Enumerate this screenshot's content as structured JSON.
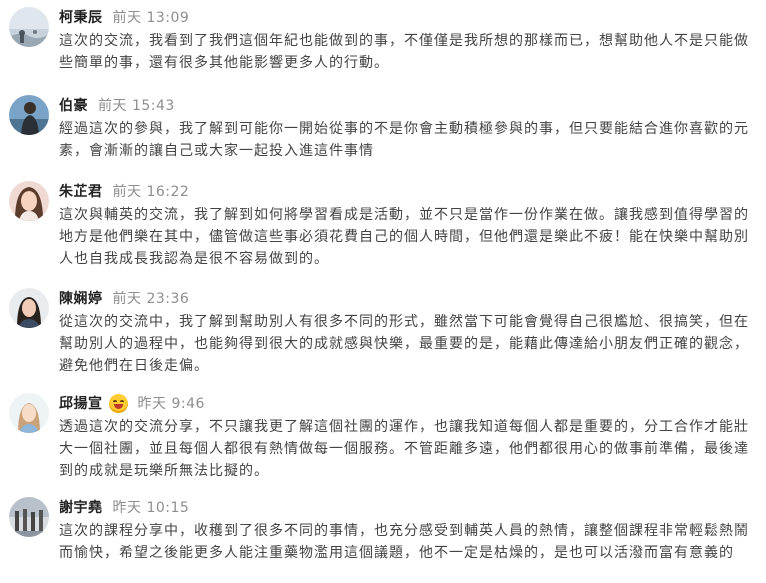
{
  "comments": [
    {
      "name": "柯秉辰",
      "time": "前天 13:09",
      "text": "這次的交流，我看到了我們這個年紀也能做到的事，不僅僅是我所想的那樣而已，想幫助他人不是只能做些簡單的事，還有很多其他能影響更多人的行動。"
    },
    {
      "name": "伯豪",
      "time": "前天 15:43",
      "text": "經過這次的參與，我了解到可能你一開始從事的不是你會主動積極參與的事，但只要能結合進你喜歡的元素，會漸漸的讓自己或大家一起投入進這件事情"
    },
    {
      "name": "朱芷君",
      "time": "前天 16:22",
      "text": "這次與輔英的交流，我了解到如何將學習看成是活動，並不只是當作一份作業在做。讓我感到值得學習的地方是他們樂在其中，儘管做這些事必須花費自己的個人時間，但他們還是樂此不疲！能在快樂中幫助別人也自我成長我認為是很不容易做到的。"
    },
    {
      "name": "陳娴婷",
      "time": "前天 23:36",
      "text": "從這次的交流中，我了解到幫助別人有很多不同的形式，雖然當下可能會覺得自己很尷尬、很搞笑，但在幫助別人的過程中，也能夠得到很大的成就感與快樂，最重要的是，能藉此傳達給小朋友們正確的觀念，避免他們在日後走偏。"
    },
    {
      "name": "邱揚宣",
      "emoji": "smiling-emoji-icon",
      "time": "昨天 9:46",
      "text": "透過這次的交流分享，不只讓我更了解這個社團的運作，也讓我知道每個人都是重要的，分工合作才能壯大一個社團，並且每個人都很有熱情做每一個服務。不管距離多遠，他們都很用心的做事前準備，最後達到的成就是玩樂所無法比擬的。"
    },
    {
      "name": "謝宇堯",
      "time": "昨天 10:15",
      "text": "這次的課程分享中，收穫到了很多不同的事情，也充分感受到輔英人員的熱情，讓整個課程非常輕鬆熱鬧而愉快，希望之後能更多人能注重藥物濫用這個議題，他不一定是枯燥的，是也可以活潑而富有意義的"
    }
  ]
}
